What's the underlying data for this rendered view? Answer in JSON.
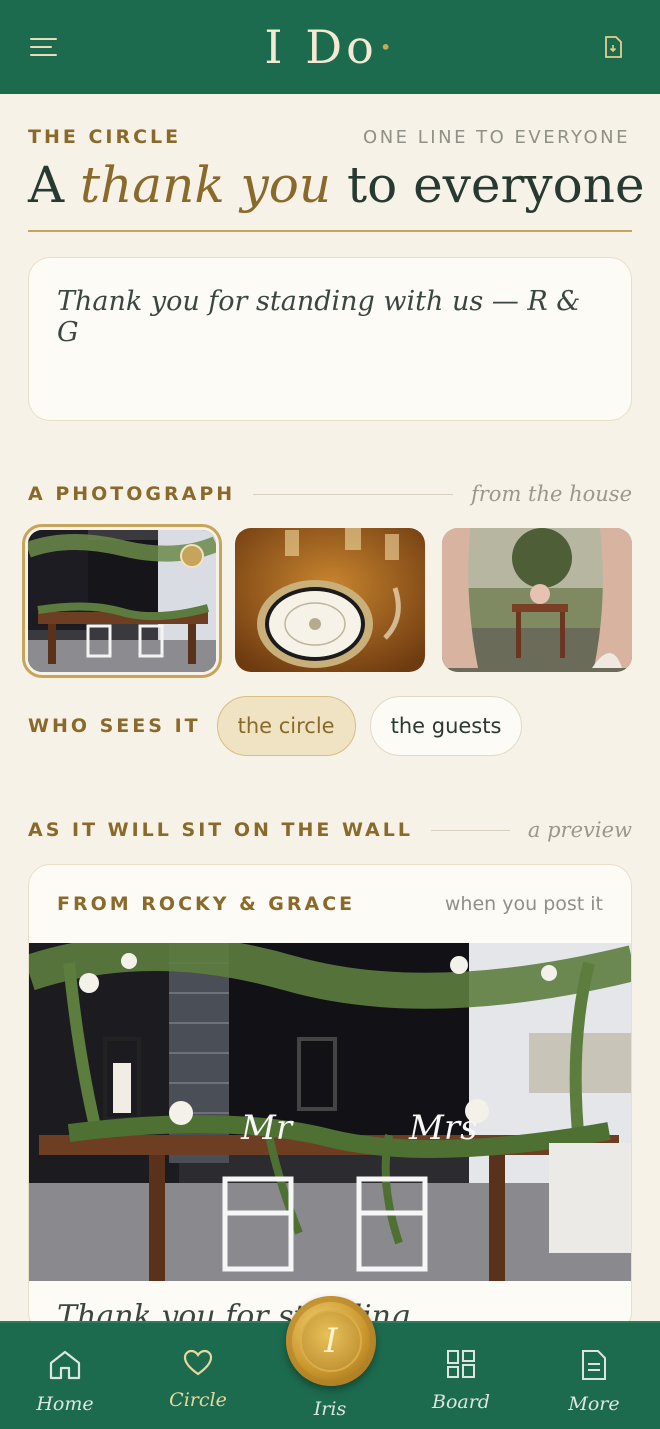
{
  "header": {
    "logo_text": "I Do",
    "menu_icon": "menu-icon",
    "action_icon": "document-download-icon"
  },
  "circle": {
    "kicker": "THE CIRCLE",
    "right_kicker": "ONE LINE TO EVERYONE",
    "title_prefix": "A",
    "title_emphasis": "thank you",
    "title_suffix": "to everyone",
    "message": "Thank you for standing with us — R & G"
  },
  "photograph": {
    "kicker": "A PHOTOGRAPH",
    "aside": "from the house",
    "thumbnails": [
      "head table with garland",
      "place setting on wood table",
      "ceremony table with drapes"
    ],
    "selected_index": 0
  },
  "audience": {
    "label": "WHO SEES IT",
    "options": [
      "the circle",
      "the guests"
    ],
    "selected": "the circle"
  },
  "preview": {
    "kicker": "AS IT WILL SIT ON THE WALL",
    "aside": "a preview",
    "card_from": "FROM ROCKY & GRACE",
    "card_when": "when you post it",
    "card_caption": "Thank you for standing"
  },
  "nav": {
    "items": [
      {
        "label": "Home",
        "icon": "home-icon"
      },
      {
        "label": "Circle",
        "icon": "heart-icon"
      },
      {
        "label": "Iris",
        "icon": "wax-seal-icon"
      },
      {
        "label": "Board",
        "icon": "grid-icon"
      },
      {
        "label": "More",
        "icon": "document-icon"
      }
    ],
    "active": "Circle",
    "seal_letter": "I"
  },
  "colors": {
    "brand_green": "#1d6b4f",
    "gold": "#8a6a2a",
    "background": "#f7f2e7"
  }
}
